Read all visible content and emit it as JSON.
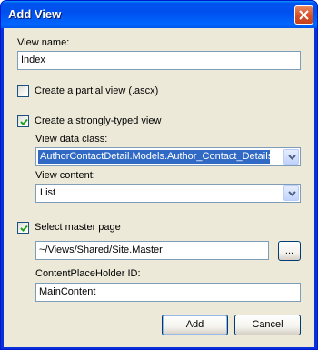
{
  "window": {
    "title": "Add View"
  },
  "view_name": {
    "label": "View name:",
    "value": "Index"
  },
  "partial_view": {
    "label": "Create a partial view (.ascx)",
    "checked": false
  },
  "strongly_typed": {
    "label": "Create a strongly-typed view",
    "checked": true
  },
  "view_data_class": {
    "label": "View data class:",
    "value": "AuthorContactDetail.Models.Author_Contact_Details"
  },
  "view_content": {
    "label": "View content:",
    "value": "List"
  },
  "master_page": {
    "label": "Select master page",
    "checked": true,
    "value": "~/Views/Shared/Site.Master",
    "browse_label": "..."
  },
  "placeholder_id": {
    "label": "ContentPlaceHolder ID:",
    "value": "MainContent"
  },
  "buttons": {
    "add": "Add",
    "cancel": "Cancel"
  },
  "icons": {
    "close": "close-icon",
    "check": "checkmark-icon",
    "dropdown": "chevron-down-icon"
  },
  "colors": {
    "titlebar": "#0054e3",
    "client_bg": "#ece9d8",
    "selection": "#316ac5",
    "close": "#d9522a"
  }
}
